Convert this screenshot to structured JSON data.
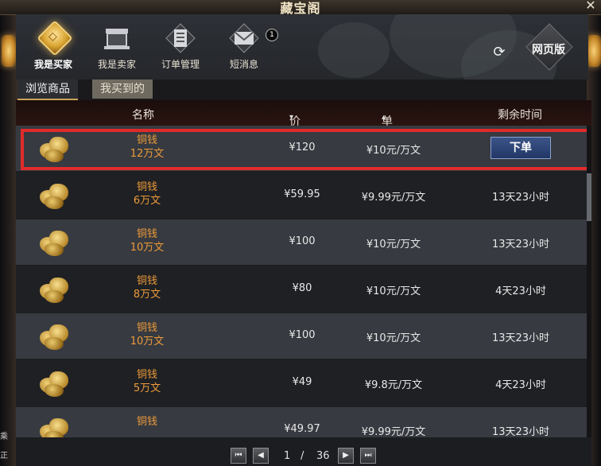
{
  "window": {
    "title": "藏宝阁",
    "close_label": "✕"
  },
  "nav": {
    "items": [
      {
        "label": "我是买家",
        "active": true
      },
      {
        "label": "我是卖家",
        "active": false
      },
      {
        "label": "订单管理",
        "active": false
      },
      {
        "label": "短消息",
        "active": false
      }
    ],
    "message_badge": "1",
    "web_version_label": "网页版",
    "refresh_icon": "refresh-icon"
  },
  "tabs": [
    {
      "label": "浏览商品",
      "active": true
    },
    {
      "label": "我买到的",
      "active": false
    }
  ],
  "table": {
    "headers": {
      "name": "名称",
      "price": "价钱",
      "unit_price": "单价",
      "remaining": "剩余时间",
      "price_sort": "▾",
      "unit_sort": "▴"
    },
    "rows": [
      {
        "name": "铜钱",
        "amount": "12万文",
        "price": "¥120",
        "unit": "¥10元/万文",
        "remaining": "",
        "action": "下单"
      },
      {
        "name": "铜钱",
        "amount": "6万文",
        "price": "¥59.95",
        "unit": "¥9.99元/万文",
        "remaining": "13天23小时",
        "action": ""
      },
      {
        "name": "铜钱",
        "amount": "10万文",
        "price": "¥100",
        "unit": "¥10元/万文",
        "remaining": "13天23小时",
        "action": ""
      },
      {
        "name": "铜钱",
        "amount": "8万文",
        "price": "¥80",
        "unit": "¥10元/万文",
        "remaining": "4天23小时",
        "action": ""
      },
      {
        "name": "铜钱",
        "amount": "10万文",
        "price": "¥100",
        "unit": "¥10元/万文",
        "remaining": "13天23小时",
        "action": ""
      },
      {
        "name": "铜钱",
        "amount": "5万文",
        "price": "¥49",
        "unit": "¥9.8元/万文",
        "remaining": "4天23小时",
        "action": ""
      },
      {
        "name": "铜钱",
        "amount": "",
        "price": "¥49.97",
        "unit": "¥9.99元/万文",
        "remaining": "13天23小时",
        "action": ""
      }
    ]
  },
  "pager": {
    "current": "1",
    "separator": "/",
    "total": "36",
    "first": "⏮",
    "prev": "◀",
    "next": "▶",
    "last": "⏭"
  },
  "side_text": {
    "left_1": "乘",
    "left_2": "正"
  },
  "colors": {
    "item_name": "#ec9a3a",
    "highlight_border": "#e02b2b",
    "order_button": "#2b4478",
    "row_light": "#373a40",
    "row_dark": "#1f2023"
  }
}
